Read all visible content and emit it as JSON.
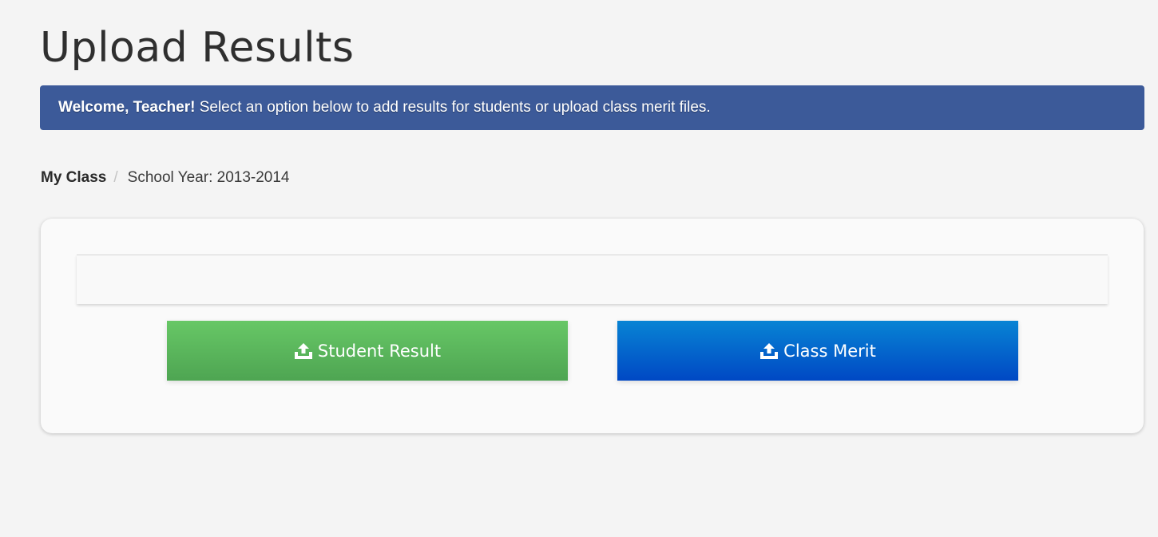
{
  "page": {
    "title": "Upload Results"
  },
  "banner": {
    "greeting": "Welcome, Teacher!",
    "message": " Select an option below to add results for students or upload class merit files."
  },
  "breadcrumb": {
    "home": "My Class",
    "separator": "/",
    "current": "School Year: 2013-2014"
  },
  "actions": {
    "student_result": {
      "label": "Student Result",
      "icon": "upload-icon",
      "color": "#5cb85c"
    },
    "class_merit": {
      "label": "Class Merit",
      "icon": "upload-icon",
      "color": "#0066cc"
    }
  },
  "colors": {
    "banner_bg": "#3c5a99",
    "page_bg": "#f4f4f4"
  }
}
